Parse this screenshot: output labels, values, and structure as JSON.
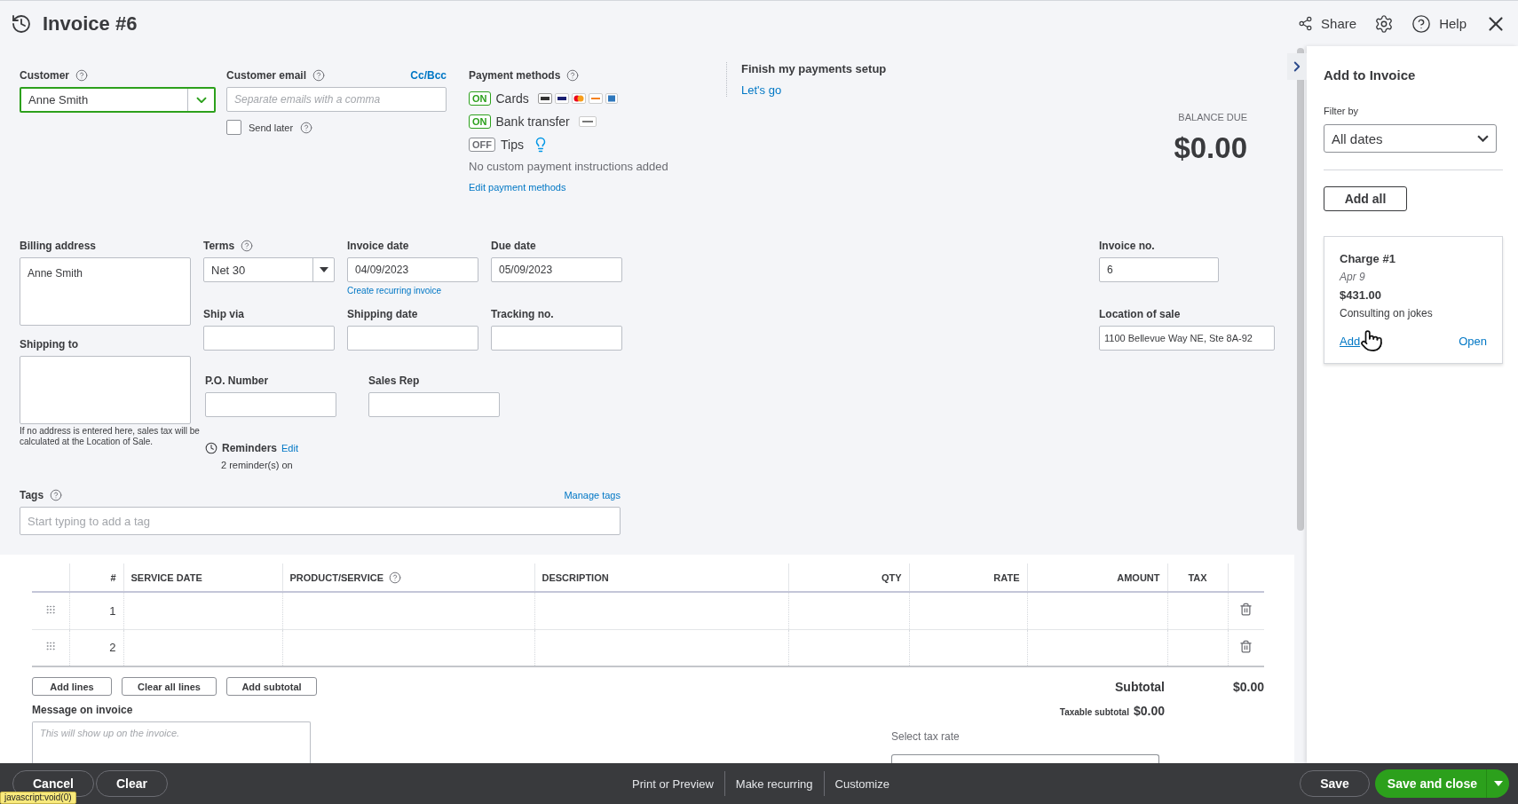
{
  "header": {
    "title": "Invoice #6",
    "actions": [
      {
        "kind": "share",
        "label": "Share"
      },
      {
        "kind": "settings"
      },
      {
        "kind": "help",
        "label": "Help"
      },
      {
        "kind": "close"
      }
    ]
  },
  "customer": {
    "label": "Customer",
    "help": true,
    "value": "Anne Smith"
  },
  "email": {
    "label": "Customer email",
    "help": true,
    "link": "Cc/Bcc",
    "placeholder": "Separate emails with a comma",
    "send_later": {
      "label": "Send later",
      "help": true,
      "checked": false
    }
  },
  "payment_methods": {
    "label": "Payment methods",
    "help": true,
    "methods": [
      {
        "kind": "cards",
        "toggle": "ON",
        "on": true,
        "label": "Cards"
      },
      {
        "kind": "bank",
        "toggle": "ON",
        "on": true,
        "label": "Bank transfer"
      },
      {
        "kind": "tips",
        "toggle": "OFF",
        "on": false,
        "label": "Tips"
      }
    ],
    "note": "No custom payment instructions added",
    "link": "Edit payment methods"
  },
  "setup": {
    "title": "Finish my payments setup",
    "link": "Let's go"
  },
  "balance": {
    "label": "BALANCE DUE",
    "amount": "$0.00"
  },
  "billing_address": {
    "label": "Billing address",
    "value": "Anne Smith"
  },
  "shipping_to": {
    "label": "Shipping to",
    "hint": "If no address is entered here, sales tax will be calculated at the Location of Sale."
  },
  "terms": {
    "label": "Terms",
    "help": true,
    "value": "Net 30"
  },
  "invoice_date": {
    "label": "Invoice date",
    "value": "04/09/2023",
    "link": "Create recurring invoice"
  },
  "due_date": {
    "label": "Due date",
    "value": "05/09/2023"
  },
  "ship_via": {
    "label": "Ship via"
  },
  "shipping_date": {
    "label": "Shipping date"
  },
  "tracking_no": {
    "label": "Tracking no."
  },
  "po_number": {
    "label": "P.O. Number"
  },
  "sales_rep": {
    "label": "Sales Rep"
  },
  "reminders": {
    "label": "Reminders",
    "link": "Edit",
    "status": "2 reminder(s) on"
  },
  "invoice_no": {
    "label": "Invoice no.",
    "value": "6"
  },
  "location": {
    "label": "Location of sale",
    "value": "1100 Bellevue Way NE, Ste 8A-92"
  },
  "tags": {
    "label": "Tags",
    "help": true,
    "link": "Manage tags",
    "placeholder": "Start typing to add a tag"
  },
  "table": {
    "columns": [
      {
        "label": "#"
      },
      {
        "label": "SERVICE DATE"
      },
      {
        "label": "PRODUCT/SERVICE",
        "help": true
      },
      {
        "label": "DESCRIPTION"
      },
      {
        "label": "QTY"
      },
      {
        "label": "RATE"
      },
      {
        "label": "AMOUNT"
      },
      {
        "label": "TAX"
      }
    ],
    "rows": [
      {
        "number": "1"
      },
      {
        "number": "2"
      }
    ]
  },
  "line_actions": [
    "Add lines",
    "Clear all lines",
    "Add subtotal"
  ],
  "message": {
    "label": "Message on invoice",
    "placeholder": "This will show up on the invoice."
  },
  "totals": {
    "subtotal_label": "Subtotal",
    "subtotal": "$0.00",
    "taxable_label": "Taxable subtotal",
    "taxable": "$0.00",
    "tax_rate_label": "Select tax rate"
  },
  "panel": {
    "title": "Add to Invoice",
    "filter_label": "Filter by",
    "filter_value": "All dates",
    "add_all": "Add all",
    "items": [
      {
        "title": "Charge #1",
        "date": "Apr 9",
        "amount": "$431.00",
        "description": "Consulting on jokes",
        "add": "Add",
        "open": "Open"
      }
    ]
  },
  "footer": {
    "left": [
      "Cancel",
      "Clear"
    ],
    "center": [
      "Print or Preview",
      "Make recurring",
      "Customize"
    ],
    "save": "Save",
    "save_close": "Save and close"
  },
  "status_tooltip": "javascript:void(0)"
}
